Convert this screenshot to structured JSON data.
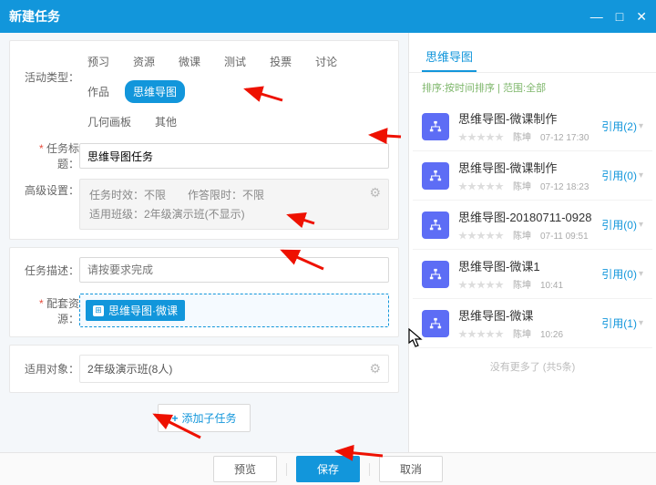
{
  "window": {
    "title": "新建任务"
  },
  "activity": {
    "label": "活动类型：",
    "tabs_row1": [
      "预习",
      "资源",
      "微课",
      "测试",
      "投票",
      "讨论",
      "作品",
      "思维导图"
    ],
    "tabs_row2": [
      "几何画板",
      "其他"
    ],
    "active": "思维导图"
  },
  "titleRow": {
    "label": "任务标题：",
    "value": "思维导图任务"
  },
  "advanced": {
    "label": "高级设置：",
    "line1": "任务时效：不限　　作答限时：不限",
    "line2": "适用班级：2年级演示班(不显示)"
  },
  "desc": {
    "label": "任务描述：",
    "placeholder": "请按要求完成"
  },
  "resource": {
    "label": "配套资源：",
    "chip": "思维导图·微课"
  },
  "target": {
    "label": "适用对象：",
    "value": "2年级演示班(8人)"
  },
  "subBtn": "添加子任务",
  "footer": {
    "preview": "预览",
    "save": "保存",
    "cancel": "取消"
  },
  "panel": {
    "tab": "思维导图",
    "sort": "排序:按时间排序 | 范围:全部",
    "items": [
      {
        "title": "思维导图-微课制作",
        "author": "陈坤",
        "time": "07-12 17:30",
        "ref": "引用(2)"
      },
      {
        "title": "思维导图-微课制作",
        "author": "陈坤",
        "time": "07-12 18:23",
        "ref": "引用(0)"
      },
      {
        "title": "思维导图-20180711-0928",
        "author": "陈坤",
        "time": "07-11 09:51",
        "ref": "引用(0)"
      },
      {
        "title": "思维导图-微课1",
        "author": "陈坤",
        "time": "10:41",
        "ref": "引用(0)"
      },
      {
        "title": "思维导图-微课",
        "author": "陈坤",
        "time": "10:26",
        "ref": "引用(1)"
      }
    ],
    "end": "没有更多了 (共5条)"
  },
  "stars": "★★★★★"
}
